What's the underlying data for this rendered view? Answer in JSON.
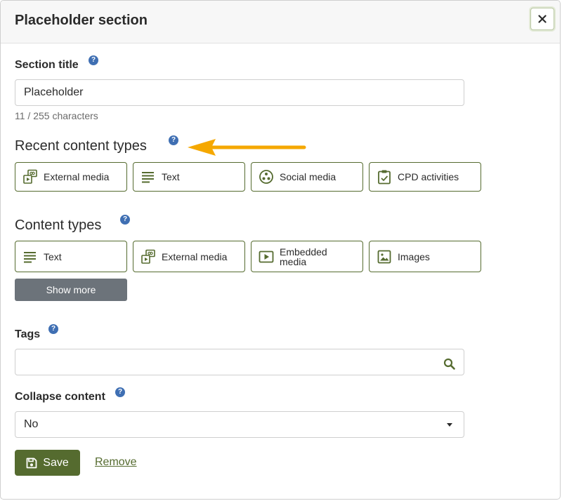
{
  "modal": {
    "title": "Placeholder section",
    "close_label": "×"
  },
  "section_title": {
    "label": "Section title",
    "help": "?",
    "value": "Placeholder",
    "char_count": "11 / 255 characters"
  },
  "recent_content_types": {
    "heading": "Recent content types",
    "help": "?",
    "items": [
      {
        "label": "External media",
        "icon": "external-media-icon"
      },
      {
        "label": "Text",
        "icon": "text-lines-icon"
      },
      {
        "label": "Social media",
        "icon": "social-media-icon"
      },
      {
        "label": "CPD activities",
        "icon": "clipboard-check-icon"
      }
    ]
  },
  "content_types": {
    "heading": "Content types",
    "help": "?",
    "items": [
      {
        "label": "Text",
        "icon": "text-lines-icon"
      },
      {
        "label": "External media",
        "icon": "external-media-icon"
      },
      {
        "label": "Embedded media",
        "icon": "play-icon"
      },
      {
        "label": "Images",
        "icon": "image-icon"
      }
    ],
    "show_more_label": "Show more"
  },
  "tags": {
    "label": "Tags",
    "help": "?",
    "value": ""
  },
  "collapse": {
    "label": "Collapse content",
    "help": "?",
    "selected": "No"
  },
  "actions": {
    "save_label": "Save",
    "remove_label": "Remove"
  },
  "colors": {
    "accent": "#556b2f",
    "help_badge": "#3f6fb3",
    "annotation_arrow": "#f5a800",
    "show_more_bg": "#6c737a"
  }
}
